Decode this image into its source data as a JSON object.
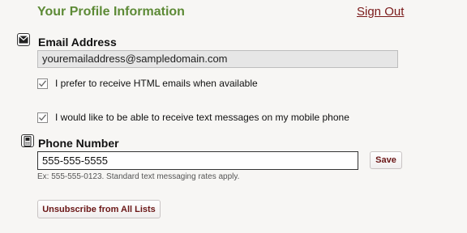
{
  "header": {
    "title": "Your Profile Information",
    "sign_out_label": "Sign Out"
  },
  "email": {
    "label": "Email Address",
    "value": "youremailaddress@sampledomain.com",
    "icon": "envelope-icon"
  },
  "options": [
    {
      "label": "I prefer to receive HTML emails when available",
      "checked": true
    },
    {
      "label": "I would like to be able to receive text messages on my mobile phone",
      "checked": true
    }
  ],
  "phone": {
    "label": "Phone Number",
    "value": "555-555-5555",
    "icon": "mobile-phone-icon",
    "save_label": "Save",
    "hint": "Ex: 555-555-0123. Standard text messaging rates apply."
  },
  "unsubscribe_label": "Unsubscribe from All Lists",
  "colors": {
    "title": "#5d8a36",
    "link": "#7a1a1a",
    "button_text": "#6a1616"
  }
}
